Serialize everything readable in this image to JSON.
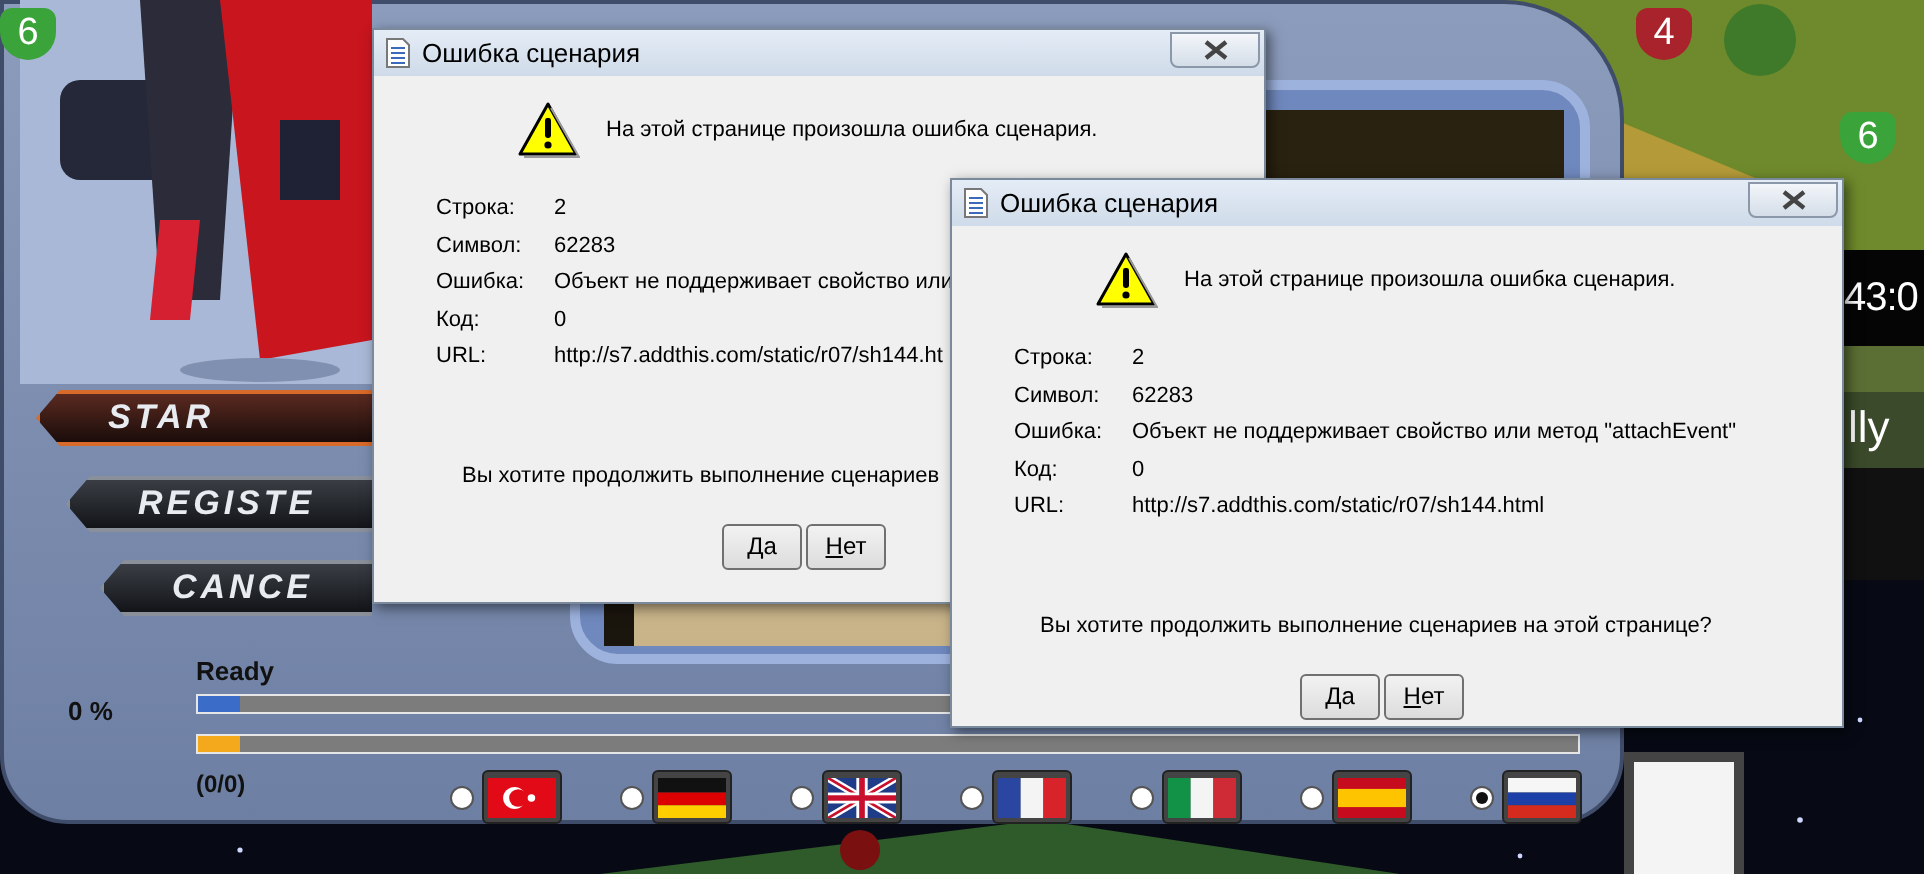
{
  "background": {
    "badges": [
      {
        "text": "6",
        "color": "#3aa33a"
      },
      {
        "text": "4",
        "color": "#a8232b"
      },
      {
        "text": "6",
        "color": "#3aa33a"
      }
    ],
    "clock": "43:0",
    "caption": "lly"
  },
  "launcher": {
    "buttons": [
      {
        "label": "STAR",
        "kind": "primary"
      },
      {
        "label": "REGISTE",
        "kind": "secondary"
      },
      {
        "label": "CANCE",
        "kind": "secondary"
      }
    ],
    "status": "Ready",
    "percent": "0 %",
    "progress": [
      {
        "kind": "file",
        "level": 0.03
      },
      {
        "kind": "total",
        "level": 0.03
      }
    ],
    "count": "(0/0)",
    "languages": [
      {
        "kind": "tr",
        "selected": false
      },
      {
        "kind": "de",
        "selected": false
      },
      {
        "kind": "gb",
        "selected": false
      },
      {
        "kind": "fr",
        "selected": false
      },
      {
        "kind": "it",
        "selected": false
      },
      {
        "kind": "es",
        "selected": false
      },
      {
        "kind": "ru",
        "selected": true
      }
    ]
  },
  "dialogs": [
    {
      "title": "Ошибка сценария",
      "message": "На этой странице произошла ошибка сценария.",
      "details": [
        {
          "label": "Строка:",
          "value": "2"
        },
        {
          "label": "Символ:",
          "value": "62283"
        },
        {
          "label": "Ошибка:",
          "value": "Объект не поддерживает свойство или"
        },
        {
          "label": "Код:",
          "value": "0"
        },
        {
          "label": "URL:",
          "value": "http://s7.addthis.com/static/r07/sh144.ht"
        }
      ],
      "question": "Вы хотите продолжить выполнение сценариев",
      "buttons": [
        "Да",
        "Нет"
      ]
    },
    {
      "title": "Ошибка сценария",
      "message": "На этой странице произошла ошибка сценария.",
      "details": [
        {
          "label": "Строка:",
          "value": "2"
        },
        {
          "label": "Символ:",
          "value": "62283"
        },
        {
          "label": "Ошибка:",
          "value": "Объект не поддерживает свойство или метод \"attachEvent\""
        },
        {
          "label": "Код:",
          "value": "0"
        },
        {
          "label": "URL:",
          "value": "http://s7.addthis.com/static/r07/sh144.html"
        }
      ],
      "question": "Вы хотите продолжить выполнение сценариев на этой странице?",
      "buttons": [
        "Да",
        "Нет"
      ]
    }
  ]
}
